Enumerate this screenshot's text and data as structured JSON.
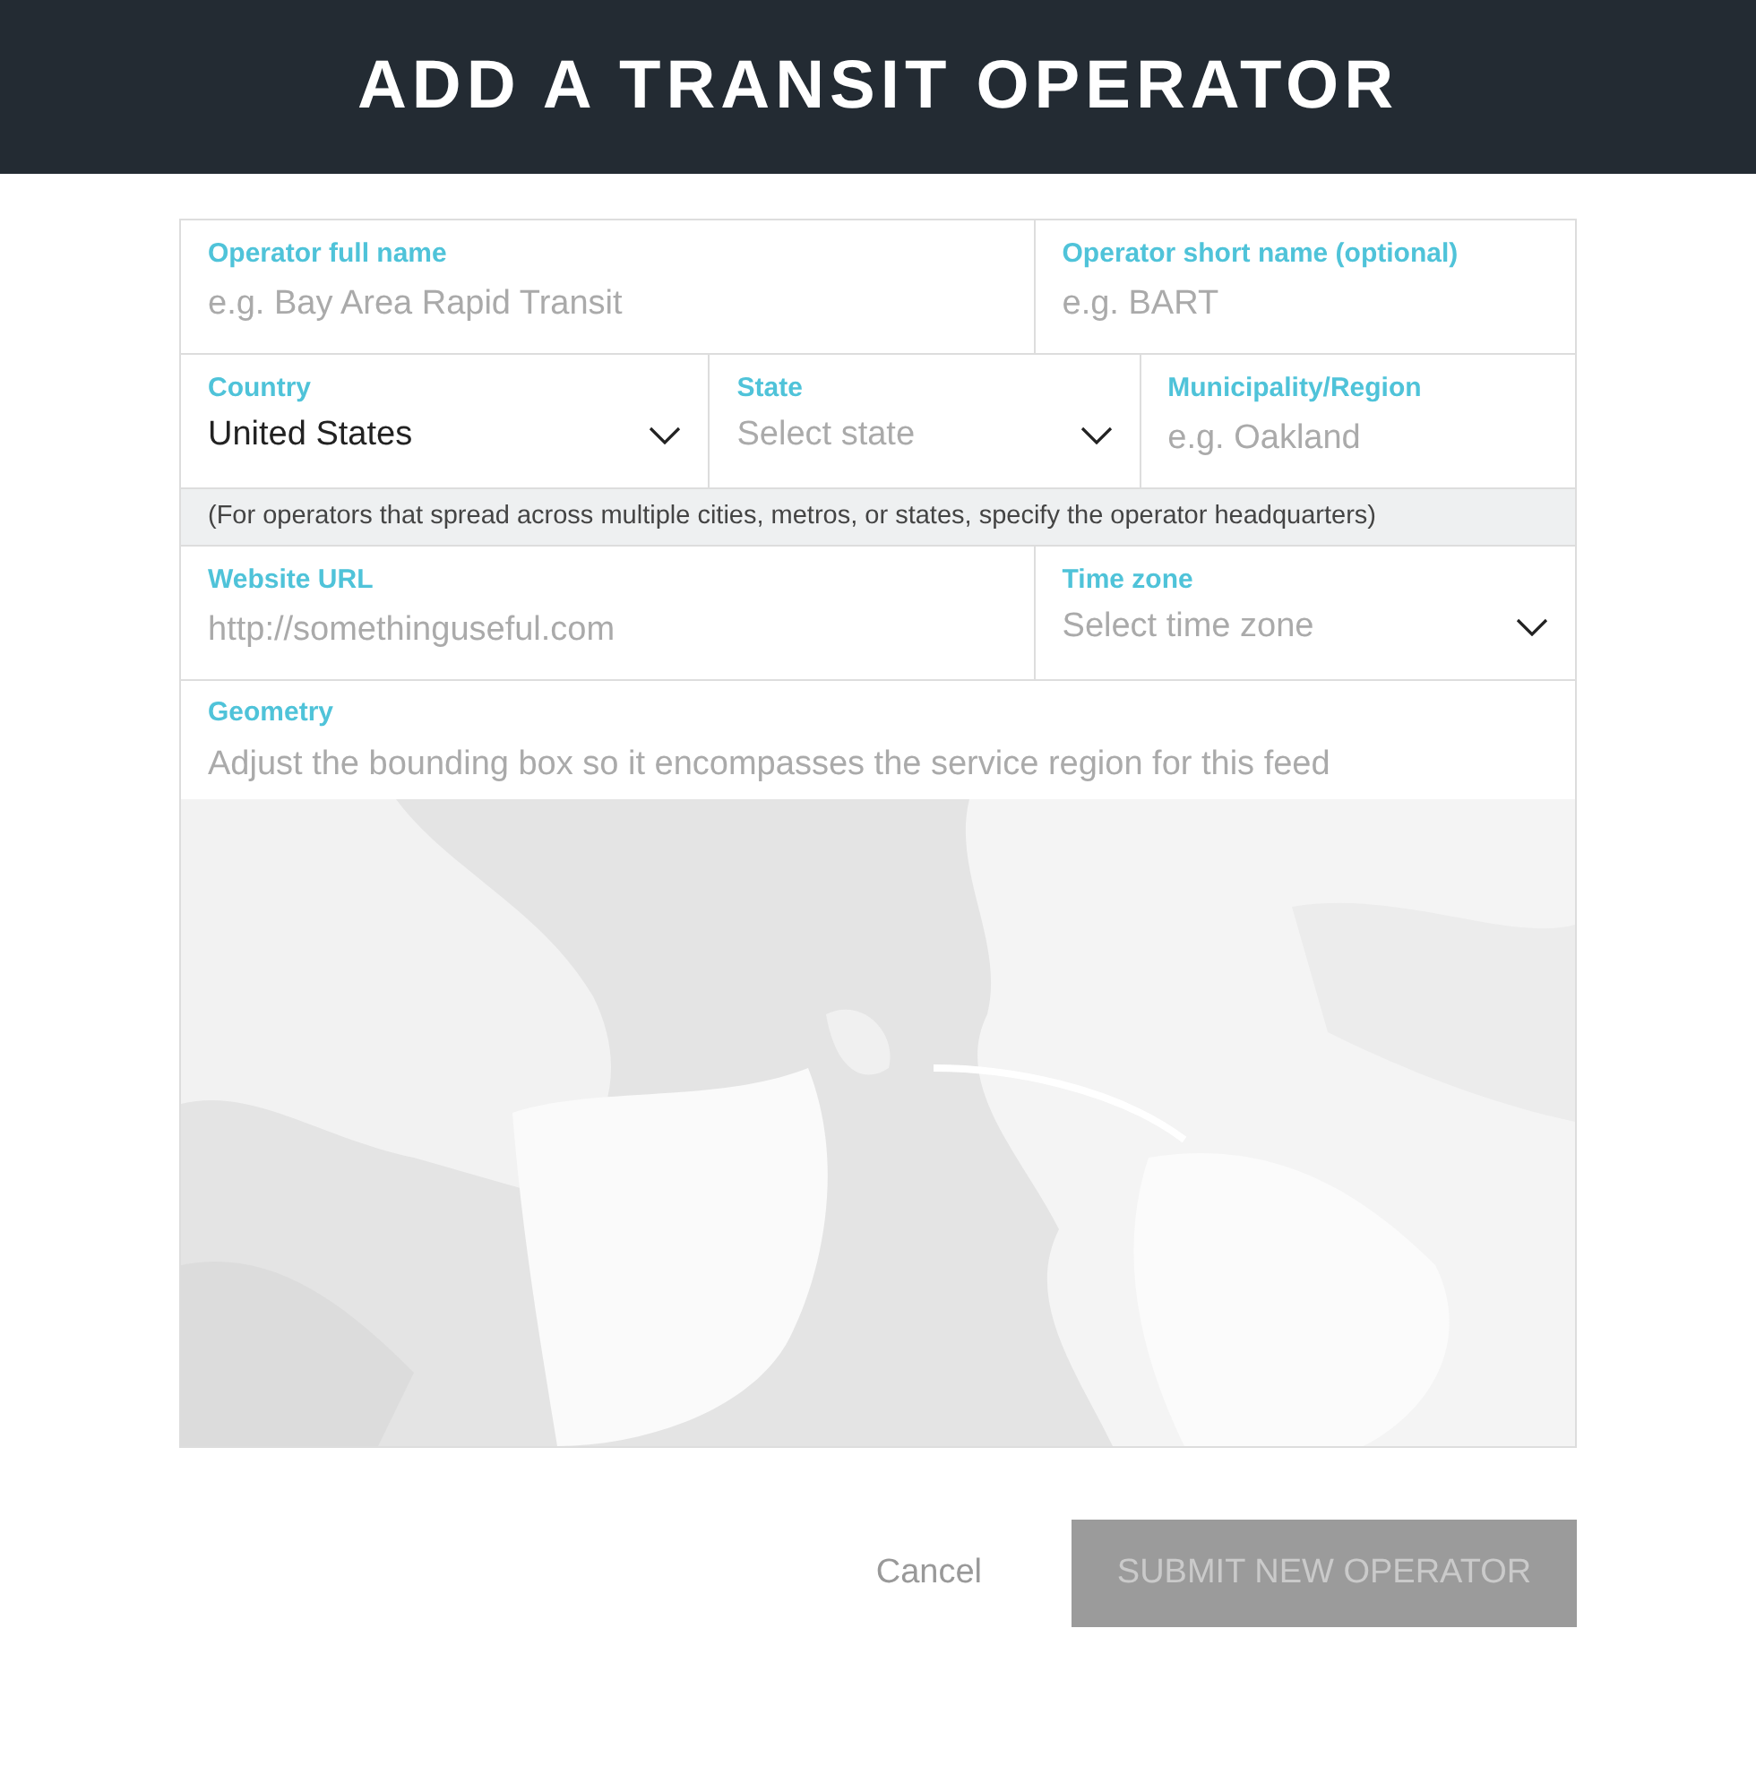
{
  "header": {
    "title": "ADD A TRANSIT OPERATOR"
  },
  "sections": [
    {
      "kind": "fields",
      "fields": [
        {
          "kind": "text",
          "label": "Operator full name",
          "placeholder": "e.g. Bay Area Rapid Transit"
        },
        {
          "kind": "text",
          "label": "Operator short name (optional)",
          "placeholder": "e.g. BART"
        }
      ]
    },
    {
      "kind": "fields",
      "fields": [
        {
          "kind": "select",
          "label": "Country",
          "value": "United States"
        },
        {
          "kind": "select",
          "label": "State",
          "placeholder": "Select state"
        },
        {
          "kind": "text",
          "label": "Municipality/Region",
          "placeholder": "e.g. Oakland"
        }
      ]
    },
    {
      "kind": "note",
      "text": "(For operators that spread across multiple cities, metros, or states, specify the operator headquarters)"
    },
    {
      "kind": "fields",
      "fields": [
        {
          "kind": "text",
          "label": "Website URL",
          "placeholder": "http://somethinguseful.com"
        },
        {
          "kind": "select",
          "label": "Time zone",
          "placeholder": "Select time zone"
        }
      ]
    },
    {
      "kind": "map",
      "label": "Geometry",
      "hint": "Adjust the bounding box so it encompasses the service region for this feed"
    }
  ],
  "actions": {
    "cancel": "Cancel",
    "submit": {
      "label": "SUBMIT NEW OPERATOR",
      "disabled": true
    }
  }
}
